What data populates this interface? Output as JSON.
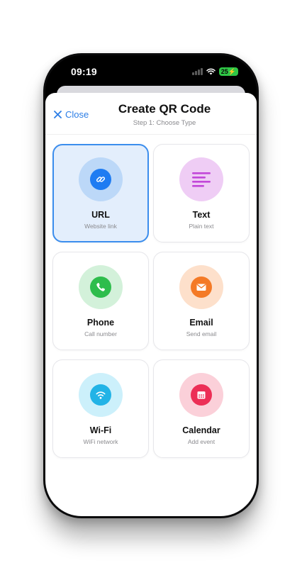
{
  "status_bar": {
    "time": "09:19",
    "battery": "25"
  },
  "header": {
    "close_label": "Close",
    "title": "Create QR Code",
    "subtitle": "Step 1: Choose Type"
  },
  "types": [
    {
      "title": "URL",
      "subtitle": "Website link",
      "selected": true,
      "icon": "link-icon"
    },
    {
      "title": "Text",
      "subtitle": "Plain text",
      "selected": false,
      "icon": "text-lines-icon"
    },
    {
      "title": "Phone",
      "subtitle": "Call number",
      "selected": false,
      "icon": "phone-icon"
    },
    {
      "title": "Email",
      "subtitle": "Send email",
      "selected": false,
      "icon": "envelope-icon"
    },
    {
      "title": "Wi-Fi",
      "subtitle": "WiFi network",
      "selected": false,
      "icon": "wifi-icon"
    },
    {
      "title": "Calendar",
      "subtitle": "Add event",
      "selected": false,
      "icon": "calendar-icon"
    }
  ],
  "colors": {
    "accent": "#2b7de6",
    "url": "#1f7cf2",
    "url_bg": "#bcd8f8",
    "text": "#c247d9",
    "text_bg": "#efcdf5",
    "phone": "#2ebd4c",
    "phone_bg": "#d3f1da",
    "email": "#f47a26",
    "email_bg": "#fde0cb",
    "wifi": "#22b3e6",
    "wifi_bg": "#ccf0fb",
    "calendar": "#ec2f56",
    "calendar_bg": "#fbd0d9"
  }
}
